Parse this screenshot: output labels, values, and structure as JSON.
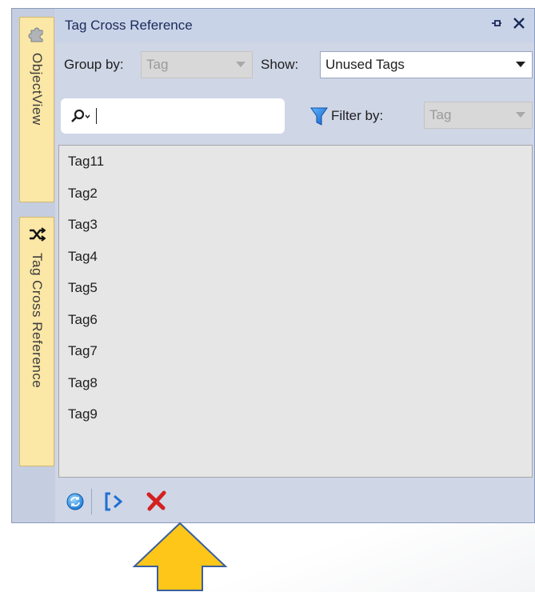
{
  "side_tabs": [
    {
      "label": "ObjectView",
      "icon": "puzzle-icon"
    },
    {
      "label": "Tag Cross Reference",
      "icon": "shuffle-icon"
    }
  ],
  "panel": {
    "title": "Tag Cross Reference",
    "group_by_label": "Group by:",
    "group_by_value": "Tag",
    "show_label": "Show:",
    "show_value": "Unused Tags",
    "search_value": "",
    "filter_by_label": "Filter by:",
    "filter_by_value": "Tag"
  },
  "tags": [
    "Tag11",
    "Tag2",
    "Tag3",
    "Tag4",
    "Tag5",
    "Tag6",
    "Tag7",
    "Tag8",
    "Tag9"
  ],
  "toolbar": {
    "icons": [
      "refresh-icon",
      "goto-icon",
      "delete-icon"
    ]
  },
  "colors": {
    "accent_title": "#1b2a5a",
    "side_tab_bg": "#fbe7a6",
    "arrow_fill": "#ffc61a",
    "delete_red": "#d42020",
    "list_bg": "#e6e6e6"
  }
}
